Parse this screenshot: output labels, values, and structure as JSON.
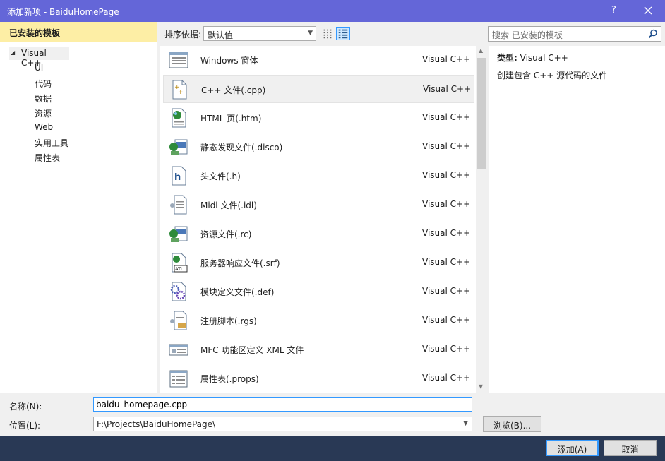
{
  "window": {
    "title": "添加新项 - BaiduHomePage",
    "help_label": "?",
    "close_icon": "close-icon"
  },
  "sidebar": {
    "header": "已安装的模板",
    "root": "Visual C++",
    "children": [
      "UI",
      "代码",
      "数据",
      "资源",
      "Web",
      "实用工具",
      "属性表"
    ]
  },
  "toolbar": {
    "sort_label": "排序依据:",
    "sort_value": "默认值",
    "view_small_icon": "small-icons-view-icon",
    "view_medium_icon": "medium-icons-view-icon"
  },
  "search": {
    "placeholder": "搜索 已安装的模板",
    "icon": "search-icon"
  },
  "templates": [
    {
      "name": "Windows 窗体",
      "lang": "Visual C++",
      "icon": "form-icon"
    },
    {
      "name": "C++ 文件(.cpp)",
      "lang": "Visual C++",
      "icon": "cpp-file-icon",
      "selected": true
    },
    {
      "name": "HTML 页(.htm)",
      "lang": "Visual C++",
      "icon": "html-page-icon"
    },
    {
      "name": "静态发现文件(.disco)",
      "lang": "Visual C++",
      "icon": "disco-file-icon"
    },
    {
      "name": "头文件(.h)",
      "lang": "Visual C++",
      "icon": "header-file-icon"
    },
    {
      "name": "Midl 文件(.idl)",
      "lang": "Visual C++",
      "icon": "idl-file-icon"
    },
    {
      "name": "资源文件(.rc)",
      "lang": "Visual C++",
      "icon": "resource-file-icon"
    },
    {
      "name": "服务器响应文件(.srf)",
      "lang": "Visual C++",
      "icon": "srf-file-icon"
    },
    {
      "name": "模块定义文件(.def)",
      "lang": "Visual C++",
      "icon": "def-file-icon"
    },
    {
      "name": "注册脚本(.rgs)",
      "lang": "Visual C++",
      "icon": "rgs-file-icon"
    },
    {
      "name": "MFC 功能区定义 XML 文件",
      "lang": "Visual C++",
      "icon": "ribbon-xml-icon"
    },
    {
      "name": "属性表(.props)",
      "lang": "Visual C++",
      "icon": "props-file-icon"
    }
  ],
  "details": {
    "type_label": "类型:",
    "type_value": "Visual C++",
    "description": "创建包含 C++ 源代码的文件"
  },
  "form": {
    "name_label": "名称(N):",
    "name_value": "baidu_homepage.cpp",
    "location_label": "位置(L):",
    "location_value": "F:\\Projects\\BaiduHomePage\\",
    "browse_label": "浏览(B)..."
  },
  "buttons": {
    "add": "添加(A)",
    "cancel": "取消"
  },
  "colors": {
    "titlebar": "#6466d8",
    "sidebar_header": "#fdeea5",
    "accent": "#3399ff",
    "frame": "#293955"
  }
}
